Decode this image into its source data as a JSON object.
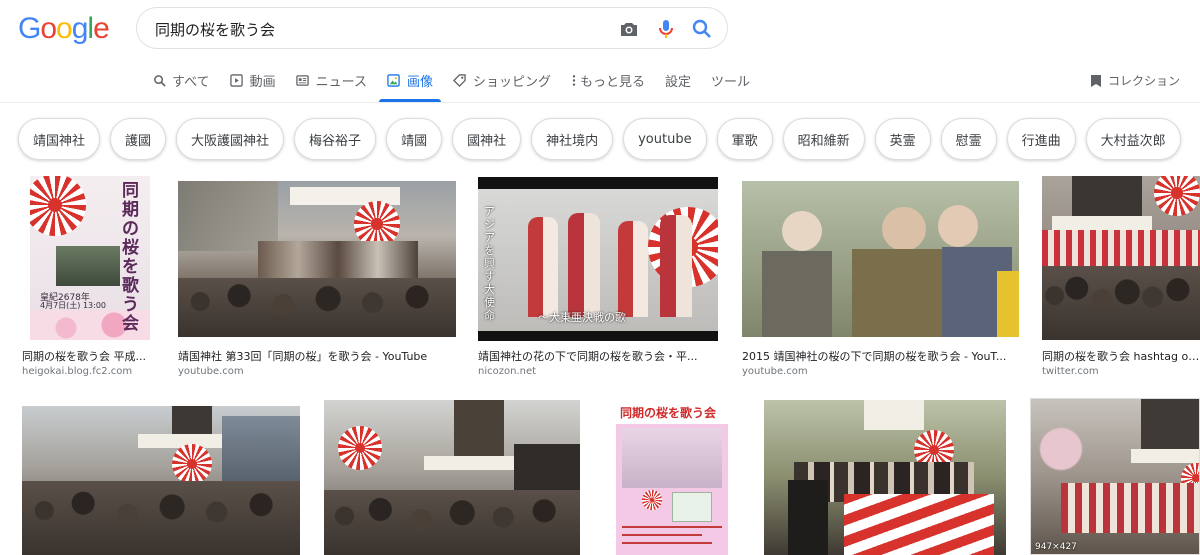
{
  "logo": {
    "letters": [
      "G",
      "o",
      "o",
      "g",
      "l",
      "e"
    ],
    "colors": [
      "#4285F4",
      "#EA4335",
      "#FBBC05",
      "#4285F4",
      "#34A853",
      "#EA4335"
    ]
  },
  "search": {
    "query": "同期の桜を歌う会"
  },
  "tabs": [
    {
      "label": "すべて",
      "icon": "search-icon"
    },
    {
      "label": "動画",
      "icon": "video-icon"
    },
    {
      "label": "ニュース",
      "icon": "news-icon"
    },
    {
      "label": "画像",
      "icon": "image-icon",
      "active": true
    },
    {
      "label": "ショッピング",
      "icon": "tag-icon"
    },
    {
      "label": "もっと見る",
      "icon": "more-icon"
    },
    {
      "label": "設定"
    },
    {
      "label": "ツール"
    }
  ],
  "collection_label": "コレクション",
  "chips": [
    "靖国神社",
    "護國",
    "大阪護國神社",
    "梅谷裕子",
    "靖國",
    "國神社",
    "神社境内",
    "youtube",
    "軍歌",
    "昭和維新",
    "英霊",
    "慰霊",
    "行進曲",
    "大村益次郎"
  ],
  "results_row1": [
    {
      "title": "同期の桜を歌う会 平成...",
      "site": "heigokai.blog.fc2.com"
    },
    {
      "title": "靖国神社 第33回「同期の桜」を歌う会 - YouTube",
      "site": "youtube.com"
    },
    {
      "title": "靖国神社の花の下で同期の桜を歌う会・平...",
      "site": "nicozon.net"
    },
    {
      "title": "2015 靖国神社の桜の下で同期の桜を歌う会 - YouT...",
      "site": "youtube.com"
    },
    {
      "title": "同期の桜を歌う会 hashtag on T",
      "site": "twitter.com"
    }
  ],
  "poster1": {
    "title_vertical": "同期の桜を歌う会",
    "date": "皇紀2678年",
    "time": "4月7日(土) 13:00"
  },
  "video3": {
    "caption": "〜大東亜決戦の歌",
    "side_text": "アジアを興す大使命"
  },
  "poster2": {
    "title": "同期の桜を歌う会"
  },
  "overlay_size": "947×427",
  "colors": {
    "accent": "#1a73e8",
    "flag_red": "#d7322c"
  }
}
